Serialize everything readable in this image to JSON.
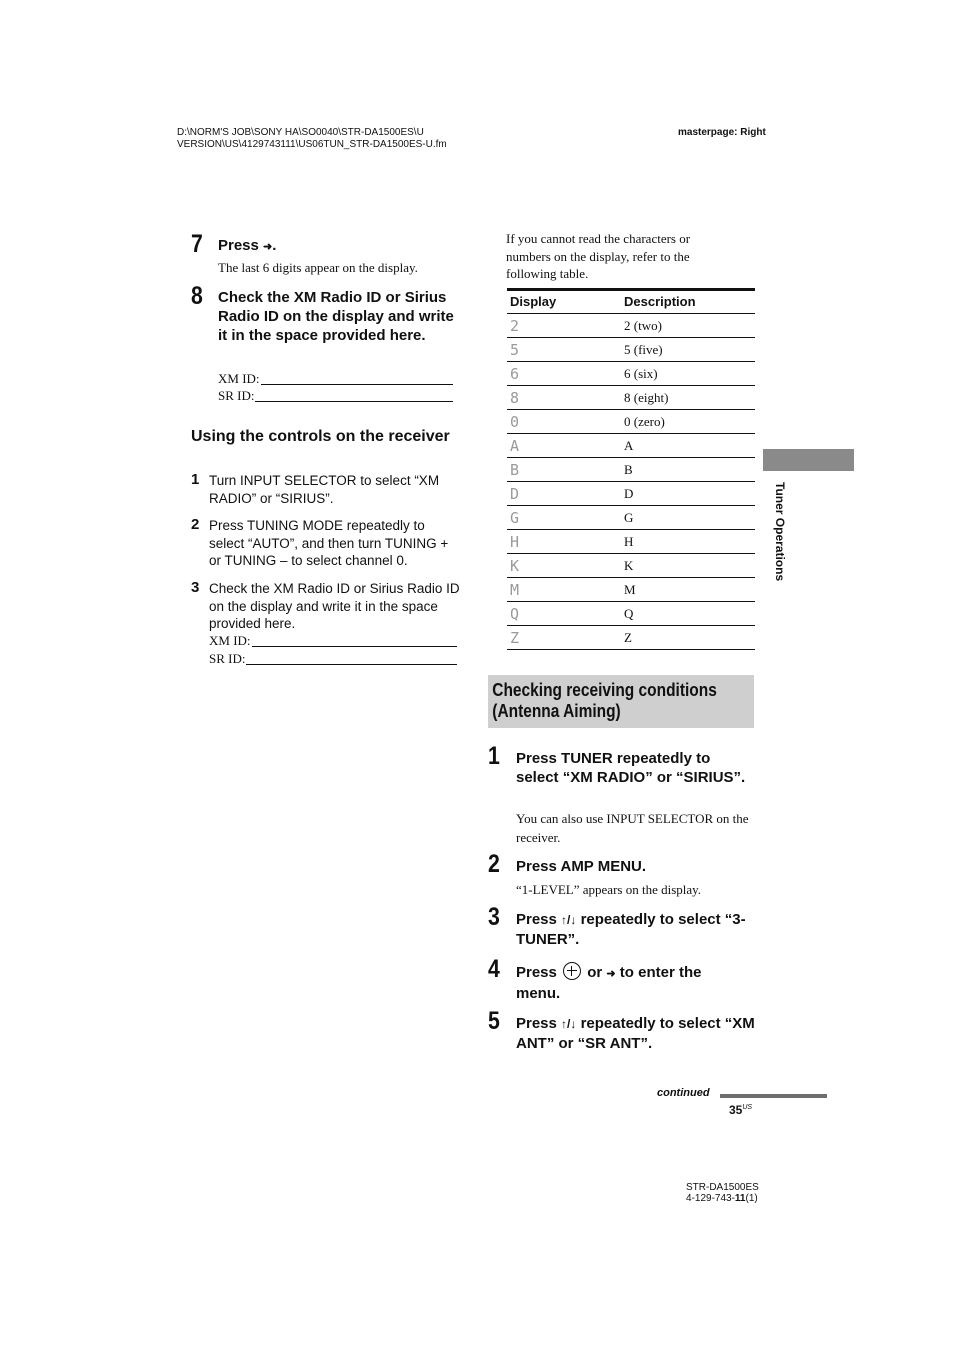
{
  "header": {
    "file_path_line1": "D:\\NORM'S JOB\\SONY HA\\SO0040\\STR-DA1500ES\\U",
    "file_path_line2": "VERSION\\US\\4129743111\\US06TUN_STR-DA1500ES-U.fm",
    "masterpage": "masterpage: Right"
  },
  "left_column": {
    "step7": {
      "number": "7",
      "title_prefix": "Press",
      "title_icon": "right-arrow",
      "title_suffix": ".",
      "body": "The last 6 digits appear on the display."
    },
    "step8": {
      "number": "8",
      "title": "Check the XM Radio ID or Sirius Radio ID on the display and write it in the space provided here.",
      "xm_label": "XM ID:",
      "sr_label": "SR ID:"
    },
    "controls_section": {
      "heading": "Using the controls on the receiver",
      "steps": [
        {
          "number": "1",
          "text": "Turn INPUT SELECTOR to select “XM RADIO” or “SIRIUS”."
        },
        {
          "number": "2",
          "text": "Press TUNING MODE repeatedly to select “AUTO”, and then turn TUNING + or TUNING – to select channel 0."
        },
        {
          "number": "3",
          "text": "Check the XM Radio ID or Sirius Radio ID on the display and write it in the space provided here."
        }
      ],
      "xm_label": "XM ID:",
      "sr_label": "SR ID:"
    }
  },
  "right_column": {
    "intro": "If you cannot read the characters or numbers on the display, refer to the following table.",
    "table": {
      "headers": [
        "Display",
        "Description"
      ],
      "rows": [
        {
          "display": "2",
          "description": "2 (two)"
        },
        {
          "display": "5",
          "description": "5 (five)"
        },
        {
          "display": "6",
          "description": "6 (six)"
        },
        {
          "display": "8",
          "description": "8 (eight)"
        },
        {
          "display": "0",
          "description": "0 (zero)"
        },
        {
          "display": "A",
          "description": "A"
        },
        {
          "display": "B",
          "description": "B"
        },
        {
          "display": "D",
          "description": "D"
        },
        {
          "display": "G",
          "description": "G"
        },
        {
          "display": "H",
          "description": "H"
        },
        {
          "display": "K",
          "description": "K"
        },
        {
          "display": "M",
          "description": "M"
        },
        {
          "display": "Q",
          "description": "Q"
        },
        {
          "display": "Z",
          "description": "Z"
        }
      ]
    },
    "section": {
      "title_line1": "Checking receiving conditions",
      "title_line2": "(Antenna Aiming)",
      "steps": [
        {
          "number": "1",
          "title": "Press TUNER repeatedly to select “XM RADIO” or “SIRIUS”.",
          "body": "You can also use INPUT SELECTOR on the receiver."
        },
        {
          "number": "2",
          "title": "Press AMP MENU.",
          "body": "“1-LEVEL” appears on the display."
        },
        {
          "number": "3",
          "title_prefix": "Press",
          "title_icon": "up-down-arrows",
          "title_suffix": "repeatedly to select “3-TUNER”."
        },
        {
          "number": "4",
          "title_prefix": "Press",
          "title_icon1": "enter-circle",
          "title_mid": "or",
          "title_icon2": "right-arrow",
          "title_suffix": "to enter the menu."
        },
        {
          "number": "5",
          "title_prefix": "Press",
          "title_icon": "up-down-arrows",
          "title_suffix": "repeatedly to select “XM ANT” or “SR ANT”."
        }
      ]
    }
  },
  "side_tab": {
    "label": "Tuner Operations"
  },
  "footer": {
    "continued": "continued",
    "page_number": "35",
    "page_suffix": "US",
    "model": "STR-DA1500ES",
    "part_number_prefix": "4-129-743-",
    "part_number_bold": "11",
    "part_number_suffix": "(1)"
  },
  "glyphs": {
    "right_arrow": "➜",
    "up_down": "↑/↓"
  }
}
